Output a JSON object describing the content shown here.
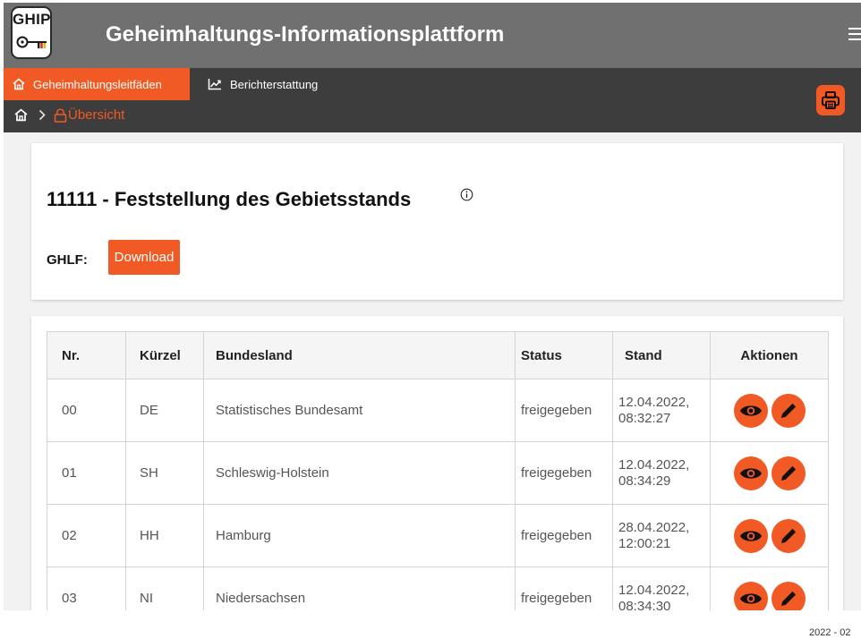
{
  "header": {
    "logo_text": "GHIP",
    "title": "Geheimhaltungs-Informationsplattform",
    "menu_icon": "hamburger-icon"
  },
  "nav": {
    "tabs": [
      {
        "label": "Geheimhaltungsleitfäden",
        "icon": "home-icon",
        "active": true
      },
      {
        "label": "Berichterstattung",
        "icon": "line-chart-icon",
        "active": false
      }
    ],
    "breadcrumb": {
      "home_icon": "home-icon",
      "separator_icon": "chevron-right-icon",
      "current": "Übersicht",
      "current_icon": "lock-icon"
    },
    "print_icon": "printer-icon"
  },
  "page": {
    "title": "11111 - Feststellung des Gebietsstands",
    "info_icon": "info-icon",
    "ghlf_label": "GHLF:",
    "download_label": "Download"
  },
  "table": {
    "headers": [
      "Nr.",
      "Kürzel",
      "Bundesland",
      "Status",
      "Stand",
      "Aktionen"
    ],
    "rows": [
      {
        "nr": "00",
        "kuerzel": "DE",
        "bundesland": "Statistisches Bundesamt",
        "status": "freigegeben",
        "stand_date": "12.04.2022,",
        "stand_time": "08:32:27"
      },
      {
        "nr": "01",
        "kuerzel": "SH",
        "bundesland": "Schleswig-Holstein",
        "status": "freigegeben",
        "stand_date": "12.04.2022,",
        "stand_time": "08:34:29"
      },
      {
        "nr": "02",
        "kuerzel": "HH",
        "bundesland": "Hamburg",
        "status": "freigegeben",
        "stand_date": "28.04.2022,",
        "stand_time": "12:00:21"
      },
      {
        "nr": "03",
        "kuerzel": "NI",
        "bundesland": "Niedersachsen",
        "status": "freigegeben",
        "stand_date": "12.04.2022,",
        "stand_time": "08:34:30"
      }
    ],
    "action_icons": [
      "eye-icon",
      "pencil-icon"
    ]
  },
  "footer": {
    "text": "2022 - 02"
  },
  "colors": {
    "accent": "#f15a24",
    "header_bg": "#707070",
    "nav_bg": "#3d3d3d",
    "page_bg": "#f2f2f2"
  }
}
